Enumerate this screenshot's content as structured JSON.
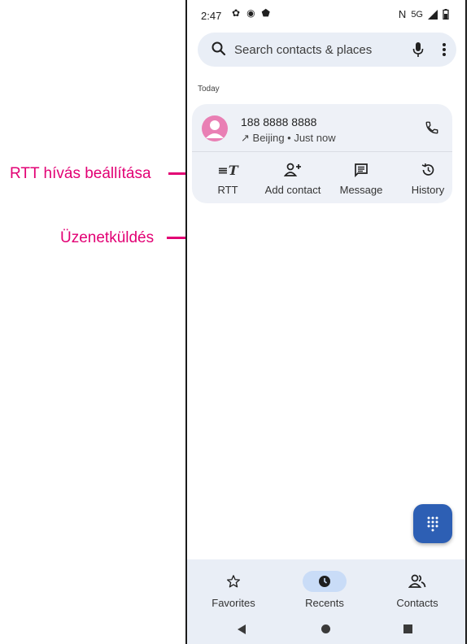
{
  "callouts": {
    "rtt": "RTT hívás beállítása",
    "message": "Üzenetküldés"
  },
  "status_bar": {
    "time": "2:47",
    "network": "5G"
  },
  "search": {
    "placeholder": "Search contacts & places"
  },
  "section_header": "Today",
  "call_entry": {
    "number": "188 8888 8888",
    "detail": "Beijing • Just now",
    "direction_arrow": "↗"
  },
  "actions": [
    {
      "label": "RTT",
      "icon": "rtt-icon"
    },
    {
      "label": "Add contact",
      "icon": "add-contact-icon"
    },
    {
      "label": "Message",
      "icon": "message-icon"
    },
    {
      "label": "History",
      "icon": "history-icon"
    }
  ],
  "bottom_nav": [
    {
      "label": "Favorites",
      "icon": "star-icon"
    },
    {
      "label": "Recents",
      "icon": "clock-icon",
      "selected": true
    },
    {
      "label": "Contacts",
      "icon": "contacts-icon"
    }
  ],
  "colors": {
    "callout": "#e20074",
    "accent": "#2d5fb4",
    "avatar": "#e97fb4"
  }
}
